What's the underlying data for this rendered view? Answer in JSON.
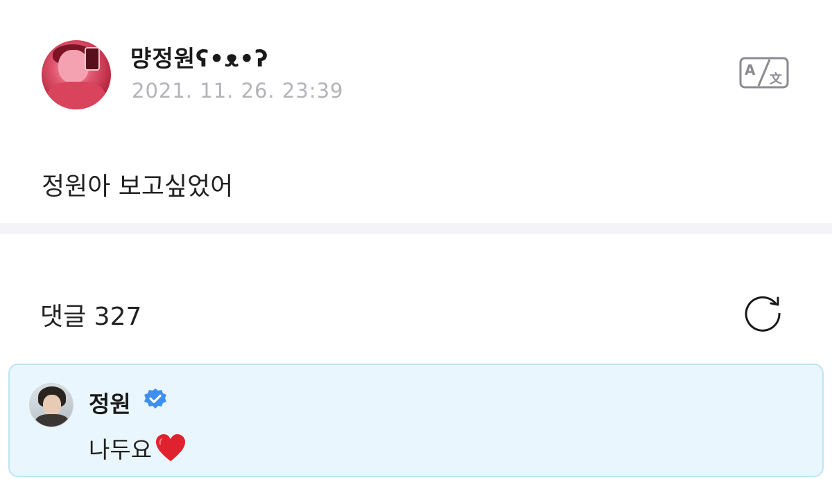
{
  "post": {
    "author": "먕정원ʕ•ᴥ•ʔ",
    "timestamp": "2021. 11. 26. 23:39",
    "body": "정원아 보고싶었어",
    "avatar_icon": "profile-photo",
    "translate_icon": "translate-icon"
  },
  "comments": {
    "header": "댓글 327",
    "refresh_icon": "refresh-icon",
    "items": [
      {
        "author": "정원",
        "verified": true,
        "text": "나두요",
        "emoji": "heart-icon",
        "accent_color": "#4a90e2"
      }
    ]
  },
  "colors": {
    "comment_bg": "#eaf6fd",
    "comment_border": "#bfe3f3",
    "timestamp": "#b3b3b8",
    "separator": "#f4f4f8",
    "verified": "#3d8ff0",
    "heart": "#e0222e"
  }
}
